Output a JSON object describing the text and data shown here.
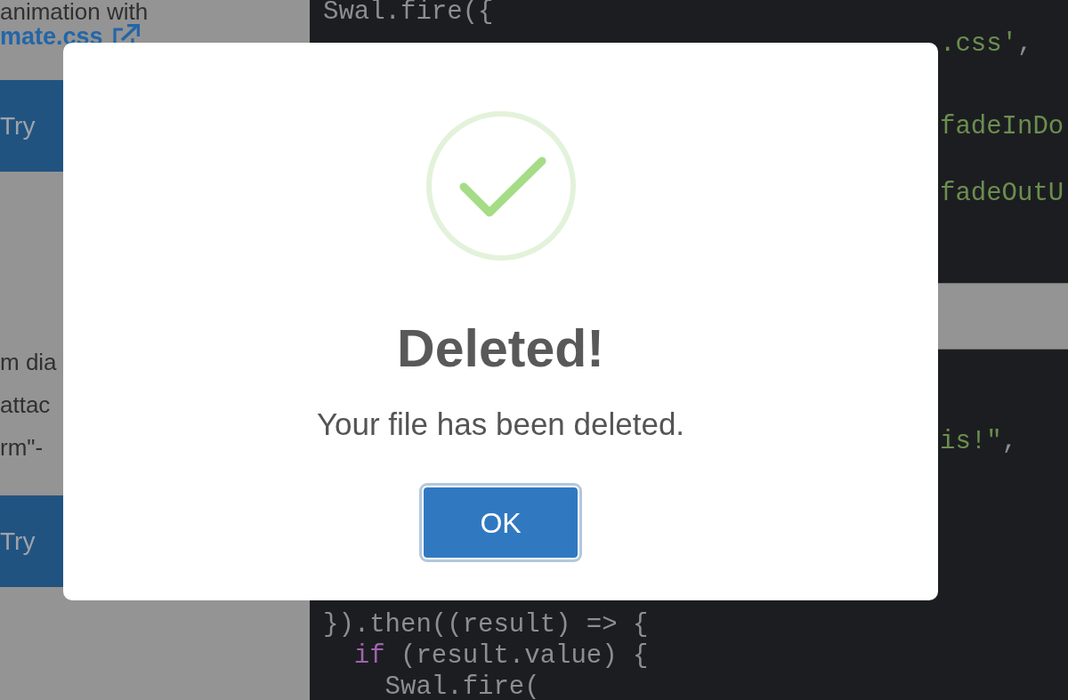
{
  "left_column": [
    {
      "kind": "paragraph",
      "lines": [
        {
          "text": "animation with",
          "link": false
        },
        {
          "text": "mate.css",
          "link": true
        }
      ]
    },
    {
      "kind": "button",
      "label": "Try"
    },
    {
      "kind": "paragraph",
      "lines": [
        {
          "text": "m dia",
          "link": false
        },
        {
          "text": "attac",
          "link": false
        },
        {
          "text": "rm\"-",
          "link": false
        }
      ]
    },
    {
      "kind": "button",
      "label": "Try"
    }
  ],
  "code_blocks": [
    {
      "lines": [
        {
          "kind": "full",
          "tokens": [
            {
              "kind": "plain",
              "text": "Swal.fire({"
            }
          ]
        },
        {
          "kind": "fragment",
          "tokens": [
            {
              "kind": "string",
              "text": ".css'"
            },
            {
              "kind": "plain",
              "text": ","
            }
          ]
        },
        {
          "kind": "fragment",
          "tokens": [
            {
              "kind": "string",
              "text": "fadeInDo"
            }
          ]
        },
        {
          "kind": "fragment",
          "tokens": [
            {
              "kind": "string",
              "text": "fadeOutU"
            }
          ]
        }
      ]
    },
    {
      "lines": [
        {
          "kind": "fragment",
          "tokens": [
            {
              "kind": "string",
              "text": "is!\""
            },
            {
              "kind": "plain",
              "text": ","
            }
          ]
        },
        {
          "kind": "full",
          "tokens": [
            {
              "kind": "plain",
              "text": "}).then((result) => {"
            }
          ]
        },
        {
          "kind": "full",
          "tokens": [
            {
              "kind": "keyword",
              "text": "  if"
            },
            {
              "kind": "plain",
              "text": " (result.value) {"
            }
          ]
        },
        {
          "kind": "full",
          "tokens": [
            {
              "kind": "plain",
              "text": "    Swal.fire("
            }
          ]
        }
      ]
    }
  ],
  "dialog": {
    "title": "Deleted!",
    "message": "Your file has been deleted.",
    "confirm_button": {
      "label": "OK",
      "focused": true
    }
  }
}
